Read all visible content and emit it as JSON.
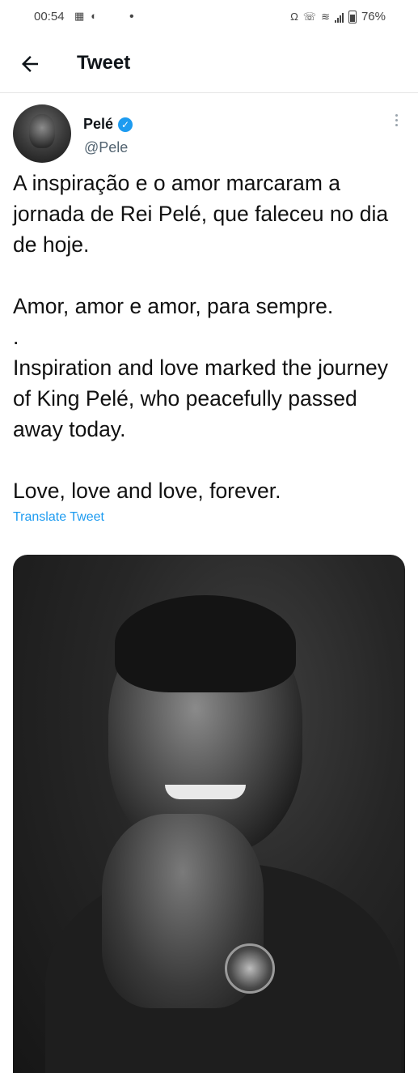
{
  "status_bar": {
    "time": "00:54",
    "battery": "76%"
  },
  "header": {
    "title": "Tweet"
  },
  "tweet": {
    "author_name": "Pelé",
    "author_handle": "@Pele",
    "paragraphs": [
      "A inspiração e o amor marcaram a jornada de Rei Pelé, que faleceu no dia de hoje.",
      "Amor, amor e amor, para sempre.",
      ".",
      "Inspiration and love marked the journey of King Pelé, who peacefully passed away today.",
      "Love, love and love, forever."
    ],
    "translate_label": "Translate Tweet"
  },
  "colors": {
    "accent": "#1d9bf0",
    "text": "#0f1419",
    "muted": "#536471"
  }
}
